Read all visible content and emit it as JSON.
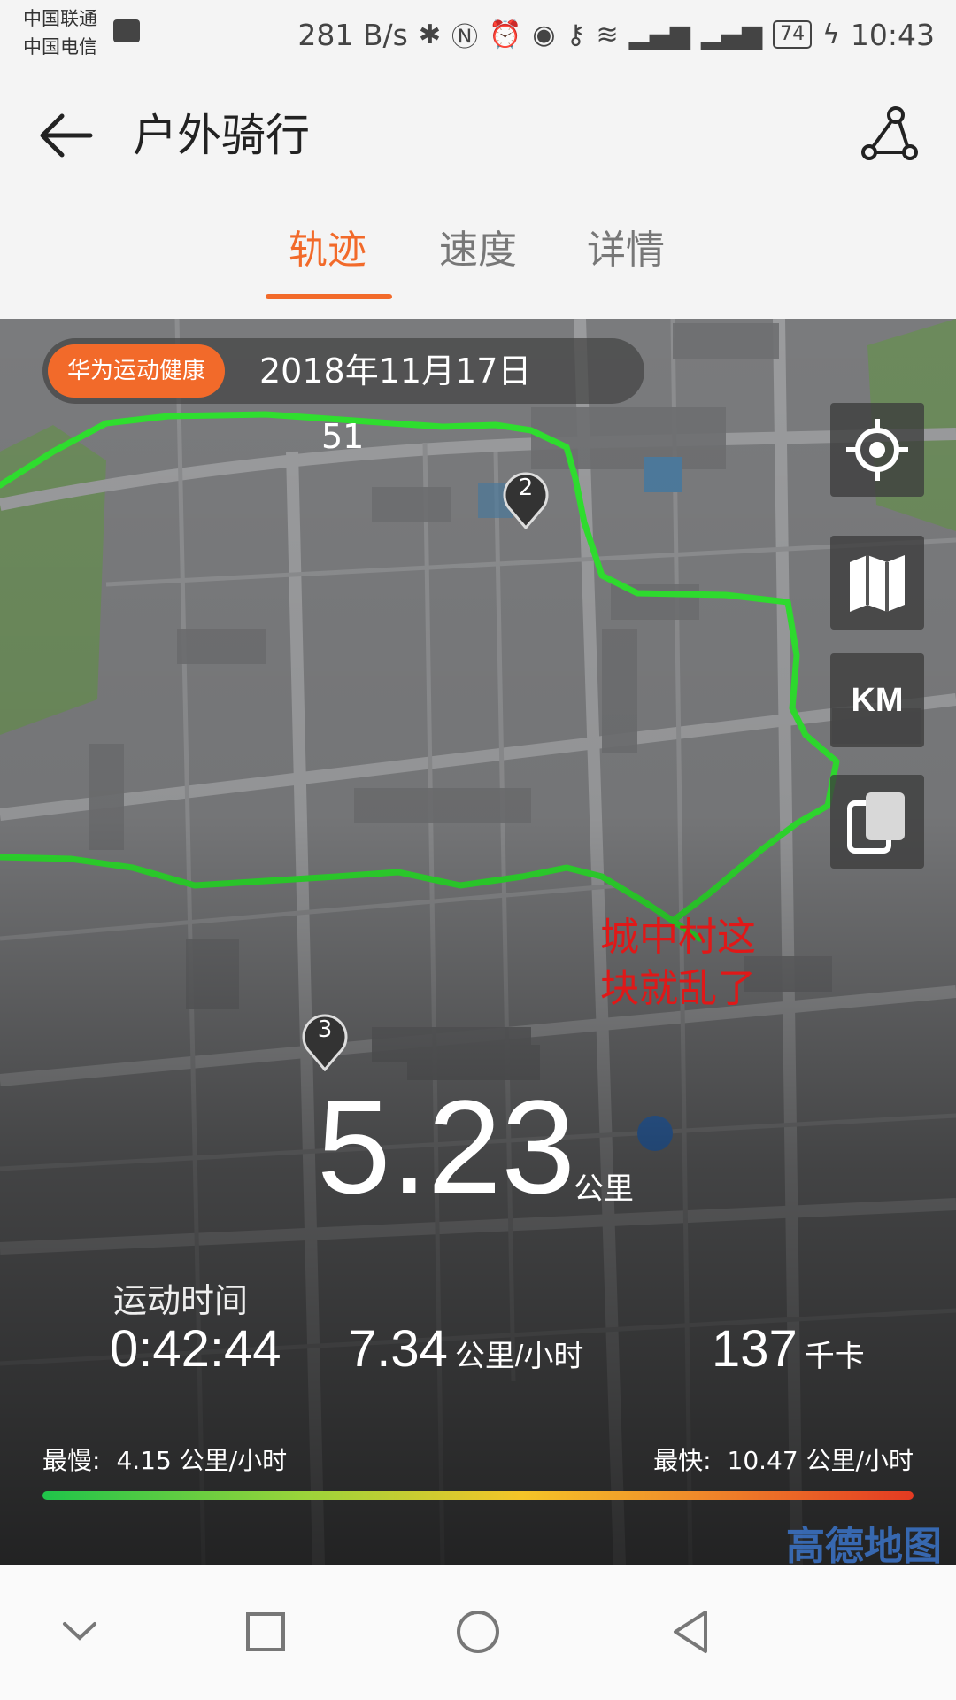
{
  "status_bar": {
    "carrier_1": "中国联通",
    "carrier_2": "中国电信",
    "net_speed": "281 B/s",
    "battery": "74",
    "time": "10:43",
    "icons": [
      "bluetooth-icon",
      "nfc-icon",
      "alarm-icon",
      "eye-icon",
      "key-icon",
      "wifi-icon",
      "signal-3g-icon",
      "signal-4g-icon",
      "charging-icon"
    ]
  },
  "header": {
    "title": "户外骑行",
    "tabs": [
      {
        "label": "轨迹",
        "active": true
      },
      {
        "label": "速度",
        "active": false
      },
      {
        "label": "详情",
        "active": false
      }
    ]
  },
  "map": {
    "source_badge": "华为运动健康",
    "date": "2018年11月17日",
    "time_suffix": "51",
    "unit_toggle": "KM",
    "annotation_line_1": "城中村这",
    "annotation_line_2": "块就乱了",
    "markers": [
      "2",
      "3"
    ],
    "watermark": "高德地图"
  },
  "summary": {
    "distance": "5.23",
    "distance_unit": "公里",
    "duration_label": "运动时间",
    "duration": "0:42:44",
    "avg_speed": "7.34",
    "avg_speed_unit": "公里/小时",
    "calories": "137",
    "calories_unit": "千卡"
  },
  "speed_range": {
    "slowest_label": "最慢:",
    "slowest_value": "4.15 公里/小时",
    "fastest_label": "最快:",
    "fastest_value": "10.47 公里/小时"
  },
  "colors": {
    "accent": "#f26a2a",
    "track": "#2fe02f",
    "annotation": "#e01818"
  }
}
